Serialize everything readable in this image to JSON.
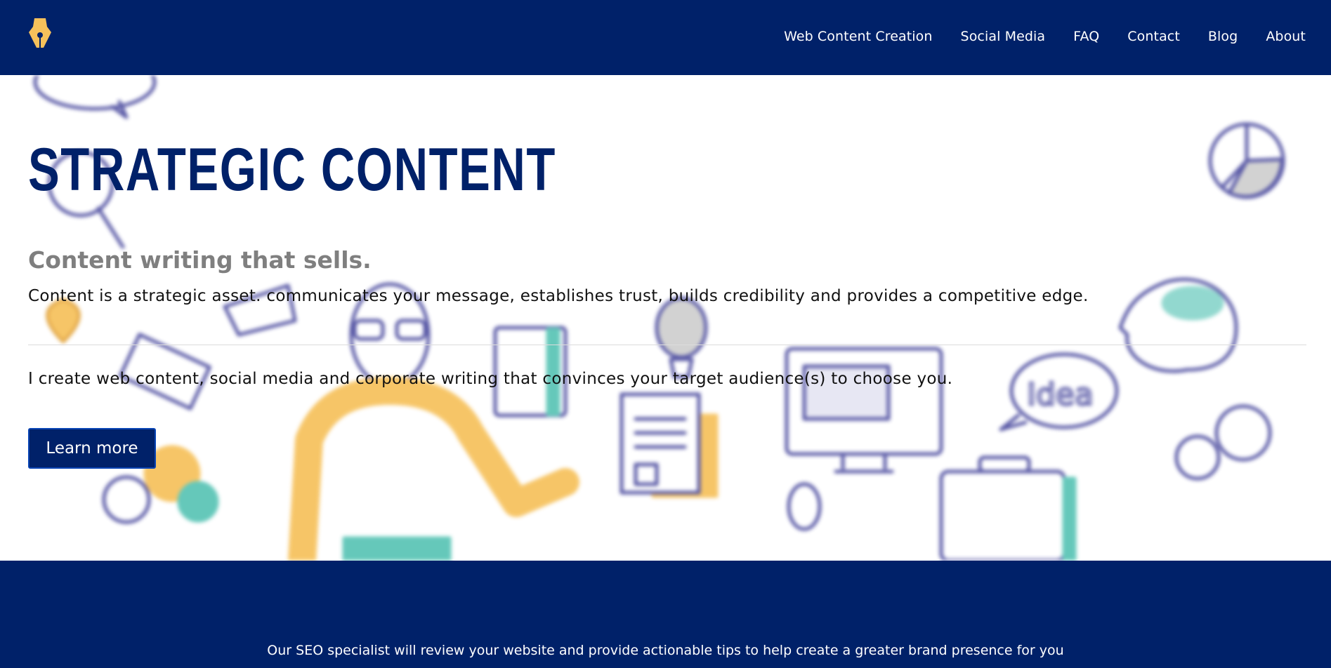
{
  "brand": {
    "logo_icon": "fountain-pen-nib-icon",
    "accent_color": "#F6C15B",
    "primary_color": "#002169"
  },
  "nav": {
    "items": [
      {
        "label": "Web Content Creation"
      },
      {
        "label": "Social Media"
      },
      {
        "label": "FAQ"
      },
      {
        "label": "Contact"
      },
      {
        "label": "Blog"
      },
      {
        "label": "About"
      }
    ]
  },
  "hero": {
    "headline": "STRATEGIC CONTENT",
    "tagline": "Content writing that sells.",
    "lead": "Content is a strategic asset. communicates your message, establishes trust, builds credibility and provides a competitive edge.",
    "body": "I create web content, social media and corporate writing that convinces your target audience(s) to choose you.",
    "cta_label": "Learn more",
    "background_illustration": "content-marketing-illustration"
  },
  "banner": {
    "text": "Our SEO specialist will review your website and provide actionable tips to help create a greater brand presence for you"
  }
}
